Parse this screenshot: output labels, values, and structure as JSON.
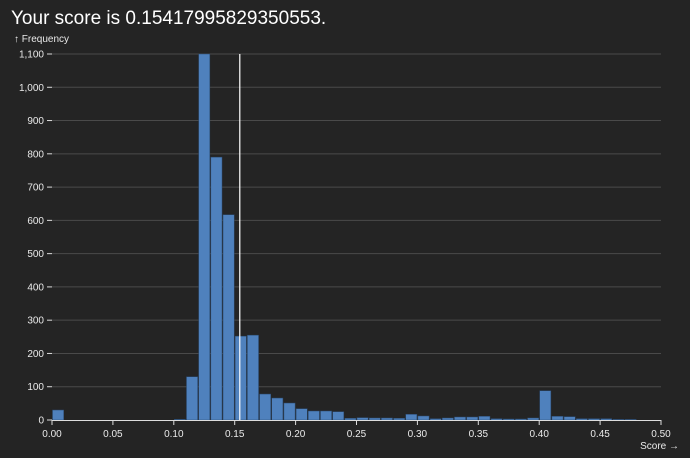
{
  "title": "Your score is 0.15417995829350553.",
  "colors": {
    "background": "#242424",
    "bar": "#4f81bd",
    "bar_stroke": "#2b4a6f",
    "grid": "#4a4a4a",
    "axis": "#dddddd",
    "marker": "#ffffff",
    "text": "#eaeaea"
  },
  "chart_data": {
    "type": "bar",
    "xlabel": "Score →",
    "ylabel": "↑ Frequency",
    "xlim": [
      0,
      0.5
    ],
    "ylim": [
      0,
      1100
    ],
    "bin_width": 0.01,
    "x_ticks": [
      0,
      0.05,
      0.1,
      0.15,
      0.2,
      0.25,
      0.3,
      0.35,
      0.4,
      0.45,
      0.5
    ],
    "x_tick_labels": [
      "0.00",
      "0.05",
      "0.10",
      "0.15",
      "0.20",
      "0.25",
      "0.30",
      "0.35",
      "0.40",
      "0.45",
      "0.50"
    ],
    "y_ticks": [
      0,
      100,
      200,
      300,
      400,
      500,
      600,
      700,
      800,
      900,
      1000,
      1100
    ],
    "y_tick_labels": [
      "0",
      "100",
      "200",
      "300",
      "400",
      "500",
      "600",
      "700",
      "800",
      "900",
      "1,000",
      "1,100"
    ],
    "grid": true,
    "bins": [
      {
        "x0": 0.0,
        "x1": 0.01,
        "count": 30
      },
      {
        "x0": 0.1,
        "x1": 0.11,
        "count": 2
      },
      {
        "x0": 0.11,
        "x1": 0.12,
        "count": 130
      },
      {
        "x0": 0.12,
        "x1": 0.13,
        "count": 1100
      },
      {
        "x0": 0.13,
        "x1": 0.14,
        "count": 790
      },
      {
        "x0": 0.14,
        "x1": 0.15,
        "count": 617
      },
      {
        "x0": 0.15,
        "x1": 0.16,
        "count": 252
      },
      {
        "x0": 0.16,
        "x1": 0.17,
        "count": 255
      },
      {
        "x0": 0.17,
        "x1": 0.18,
        "count": 78
      },
      {
        "x0": 0.18,
        "x1": 0.19,
        "count": 66
      },
      {
        "x0": 0.19,
        "x1": 0.2,
        "count": 51
      },
      {
        "x0": 0.2,
        "x1": 0.21,
        "count": 34
      },
      {
        "x0": 0.21,
        "x1": 0.22,
        "count": 27
      },
      {
        "x0": 0.22,
        "x1": 0.23,
        "count": 27
      },
      {
        "x0": 0.23,
        "x1": 0.24,
        "count": 25
      },
      {
        "x0": 0.24,
        "x1": 0.25,
        "count": 5
      },
      {
        "x0": 0.25,
        "x1": 0.26,
        "count": 7
      },
      {
        "x0": 0.26,
        "x1": 0.27,
        "count": 6
      },
      {
        "x0": 0.27,
        "x1": 0.28,
        "count": 6
      },
      {
        "x0": 0.28,
        "x1": 0.29,
        "count": 5
      },
      {
        "x0": 0.29,
        "x1": 0.3,
        "count": 17
      },
      {
        "x0": 0.3,
        "x1": 0.31,
        "count": 12
      },
      {
        "x0": 0.31,
        "x1": 0.32,
        "count": 4
      },
      {
        "x0": 0.32,
        "x1": 0.33,
        "count": 6
      },
      {
        "x0": 0.33,
        "x1": 0.34,
        "count": 9
      },
      {
        "x0": 0.34,
        "x1": 0.35,
        "count": 9
      },
      {
        "x0": 0.35,
        "x1": 0.36,
        "count": 11
      },
      {
        "x0": 0.36,
        "x1": 0.37,
        "count": 4
      },
      {
        "x0": 0.37,
        "x1": 0.38,
        "count": 3
      },
      {
        "x0": 0.38,
        "x1": 0.39,
        "count": 3
      },
      {
        "x0": 0.39,
        "x1": 0.4,
        "count": 6
      },
      {
        "x0": 0.4,
        "x1": 0.41,
        "count": 88
      },
      {
        "x0": 0.41,
        "x1": 0.42,
        "count": 11
      },
      {
        "x0": 0.42,
        "x1": 0.43,
        "count": 10
      },
      {
        "x0": 0.43,
        "x1": 0.44,
        "count": 4
      },
      {
        "x0": 0.44,
        "x1": 0.45,
        "count": 4
      },
      {
        "x0": 0.45,
        "x1": 0.46,
        "count": 4
      },
      {
        "x0": 0.46,
        "x1": 0.47,
        "count": 1
      },
      {
        "x0": 0.47,
        "x1": 0.48,
        "count": 1
      }
    ],
    "marker_x": 0.15417995829350553
  }
}
